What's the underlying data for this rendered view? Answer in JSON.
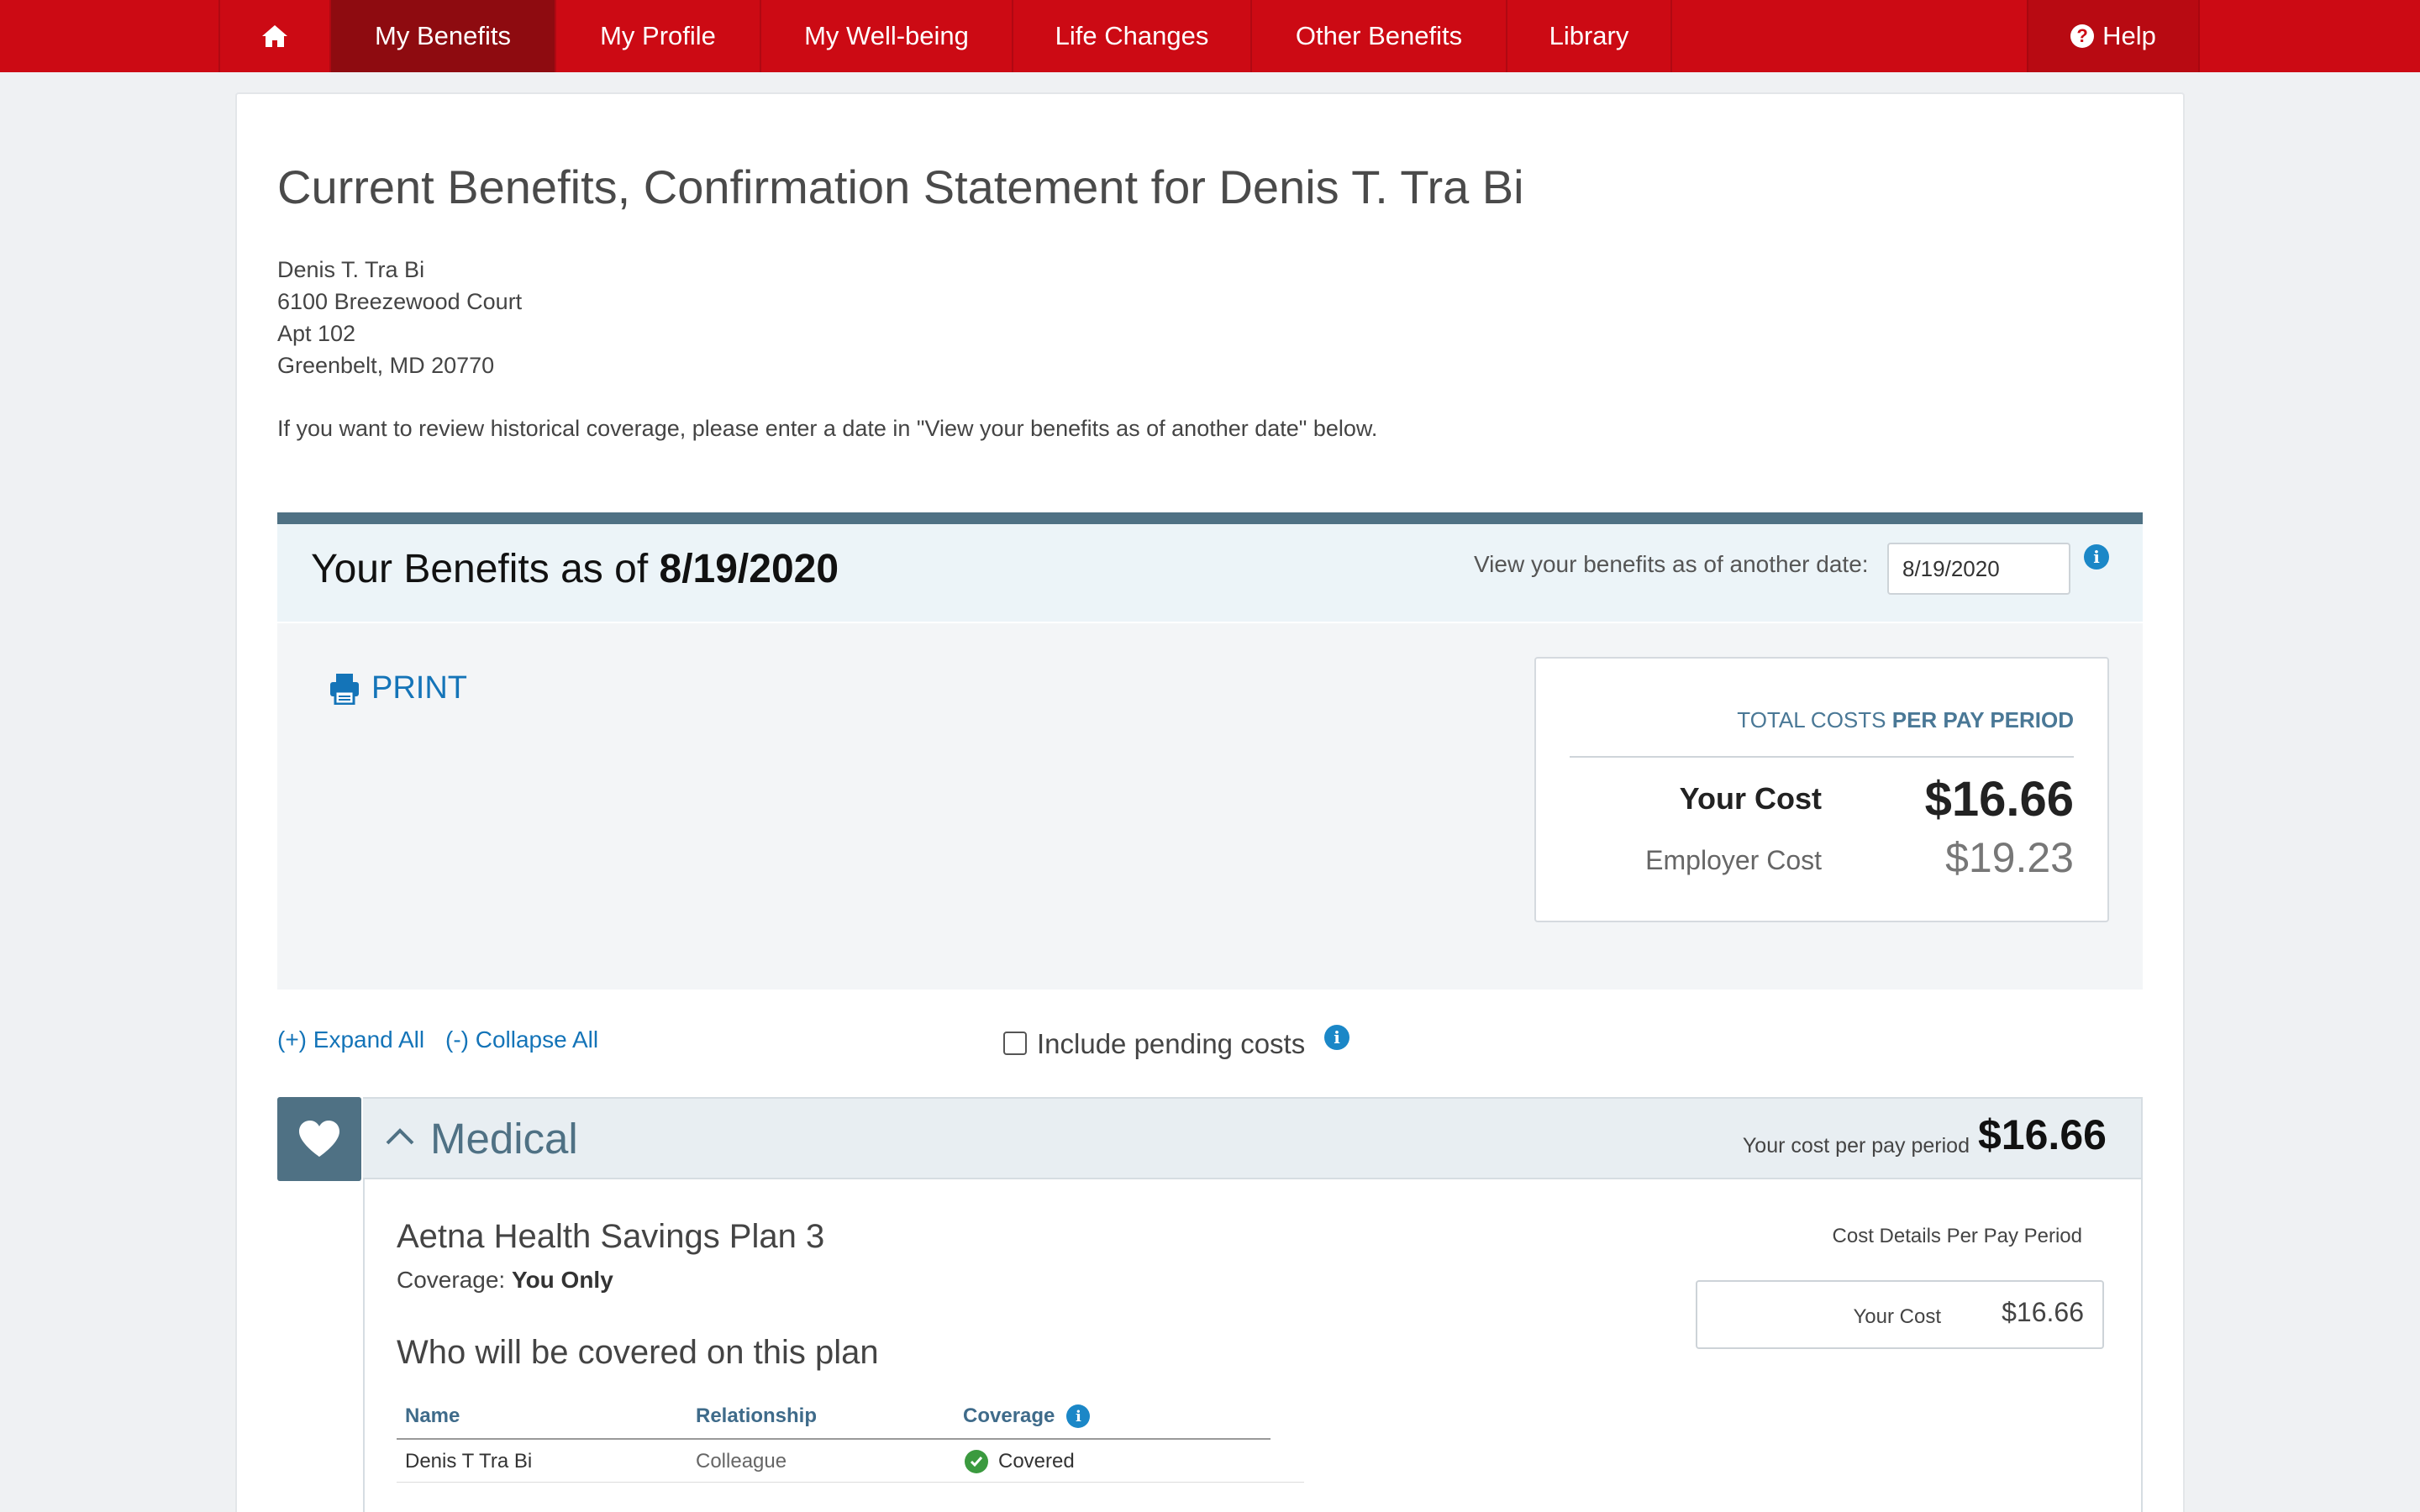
{
  "nav": {
    "home_icon": "home-icon",
    "items": [
      "My Benefits",
      "My Profile",
      "My Well-being",
      "Life Changes",
      "Other Benefits",
      "Library"
    ],
    "active": "My Benefits",
    "help": "Help"
  },
  "colors": {
    "nav_red": "#cc0a14",
    "nav_active": "#8e0b10",
    "accent_slate": "#4f7184",
    "link_blue": "#1474b8",
    "info_blue": "#1b87c7",
    "covered_green": "#3b9a3f"
  },
  "page": {
    "title": "Current Benefits, Confirmation Statement for Denis T. Tra Bi",
    "address": [
      "Denis T. Tra Bi",
      "6100 Breezewood Court",
      "Apt 102",
      "Greenbelt, MD 20770"
    ],
    "hint": "If you want to review historical coverage, please enter a date in \"View your benefits as of another date\" below."
  },
  "benefits": {
    "title_prefix": "Your Benefits as of",
    "date": "8/19/2020",
    "other_date_label": "View your benefits as of another date:",
    "other_date_value": "8/19/2020",
    "print_label": "PRINT",
    "total_head_prefix": "TOTAL COSTS",
    "total_head_suffix": "PER PAY PERIOD",
    "your_cost_label": "Your Cost",
    "your_cost_value": "$16.66",
    "employer_cost_label": "Employer Cost",
    "employer_cost_value": "$19.23"
  },
  "controls": {
    "expand_all": "(+) Expand All",
    "collapse_all": "(-) Collapse All",
    "include_pending": "Include pending costs",
    "include_pending_checked": false
  },
  "medical": {
    "title": "Medical",
    "cost_label": "Your cost per pay period",
    "cost_value": "$16.66",
    "plan_name": "Aetna Health Savings Plan 3",
    "coverage_label": "Coverage:",
    "coverage_value": "You Only",
    "who_title": "Who will be covered on this plan",
    "table": {
      "headers": [
        "Name",
        "Relationship",
        "Coverage"
      ],
      "rows": [
        {
          "name": "Denis T Tra Bi",
          "relationship": "Colleague",
          "coverage": "Covered"
        }
      ]
    },
    "cost_details_label": "Cost Details Per Pay Period",
    "cost_details_your_label": "Your Cost",
    "cost_details_your_value": "$16.66"
  }
}
